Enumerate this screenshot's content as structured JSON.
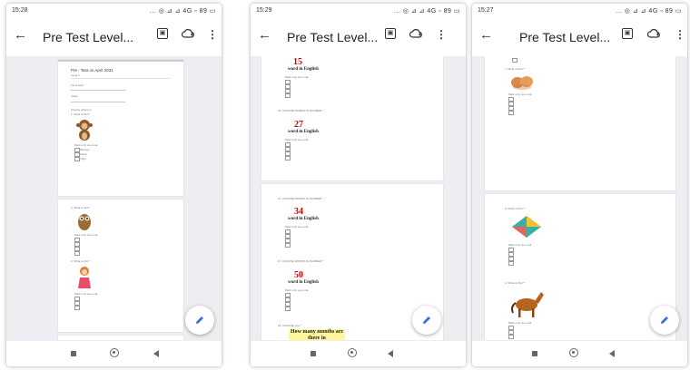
{
  "phones": [
    {
      "status_time": "15:28",
      "status_icons": "... ◎ ⊿ ⊿ 4G ▫ 89 ▭",
      "title": "Pre Test Level...",
      "form_heading": "Pre - Test on April 2021",
      "form_subheading": "Level 1",
      "field_1": "1st of April",
      "field_2": "Class",
      "q_left": "Choose what is it",
      "choice_labels": [
        "Monkey",
        "Zebra",
        "Tiger"
      ]
    },
    {
      "status_time": "15:29",
      "status_icons": "... ◎ ⊿ ⊿ 4G ▫ 89 ▭",
      "title": "Pre Test Level...",
      "numbers": [
        "15",
        "27",
        "34",
        "50"
      ],
      "word_label": "word in English",
      "questions": [
        "15. CHOOSE WORDS IN NUMBER *",
        "16. CHOOSE WORDS IN NUMBER *",
        "17. CHOOSE WORDS IN NUMBER *",
        "18. CHOOSE one *"
      ],
      "yellow_text": "How many months are there in"
    },
    {
      "status_time": "15:27",
      "status_icons": "... ◎ ⊿ ⊿ 4G ▫ 89 ▭",
      "title": "Pre Test Level...",
      "questions": [
        "7. What is this? *",
        "8. What is this? *",
        "9. What is this? *"
      ]
    }
  ],
  "icons": {
    "back": "arrow-left-icon",
    "preview": "preview-icon",
    "cloud": "cloud-add-icon",
    "more": "more-vert-icon",
    "edit": "pencil-icon"
  },
  "colors": {
    "number_red": "#d40000",
    "fab_pencil": "#3b6fd6",
    "highlight": "#fff59a"
  }
}
